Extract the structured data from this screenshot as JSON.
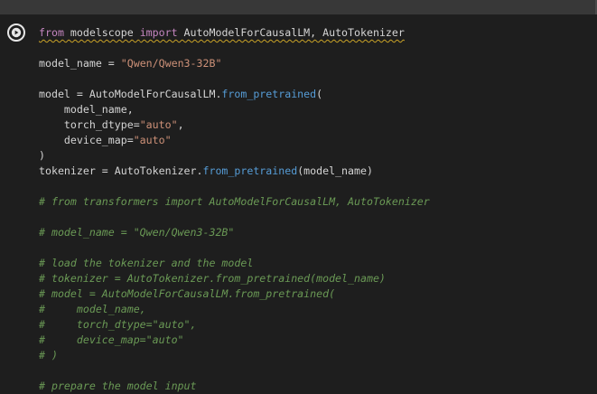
{
  "notebook": {
    "run_button_label": "",
    "code_lines": [
      "from modelscope import AutoModelForCausalLM, AutoTokenizer",
      "",
      "model_name = \"Qwen/Qwen3-32B\"",
      "",
      "model = AutoModelForCausalLM.from_pretrained(",
      "    model_name,",
      "    torch_dtype=\"auto\",",
      "    device_map=\"auto\"",
      ")",
      "tokenizer = AutoTokenizer.from_pretrained(model_name)",
      "",
      "# from transformers import AutoModelForCausalLM, AutoTokenizer",
      "",
      "# model_name = \"Qwen/Qwen3-32B\"",
      "",
      "# load the tokenizer and the model",
      "# tokenizer = AutoTokenizer.from_pretrained(model_name)",
      "# model = AutoModelForCausalLM.from_pretrained(",
      "#     model_name,",
      "#     torch_dtype=\"auto\",",
      "#     device_map=\"auto\"",
      "# )",
      "",
      "# prepare the model input"
    ]
  },
  "colors": {
    "background": "#1e1e1e",
    "keyword": "#c586c0",
    "string": "#ce9178",
    "function": "#569cd6",
    "comment": "#6a9955"
  },
  "icons": {
    "run": "play-circle-icon"
  }
}
